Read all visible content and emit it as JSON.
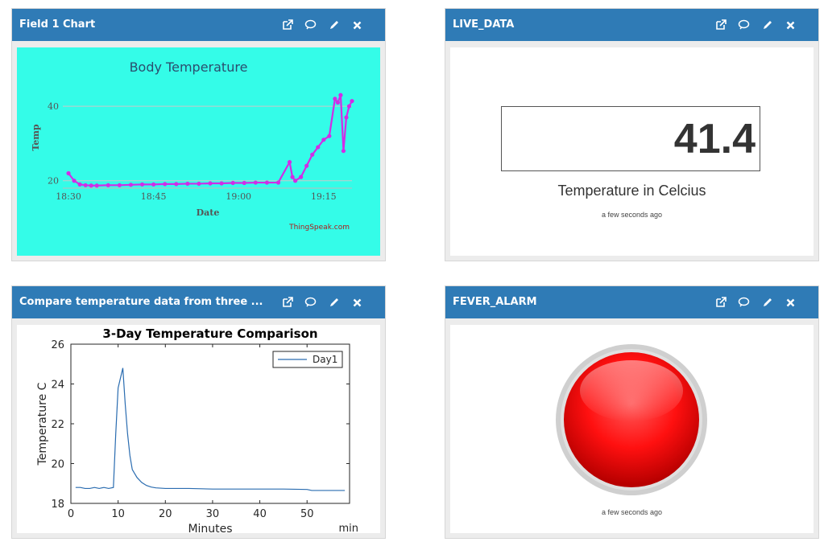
{
  "widgets": {
    "field_chart": {
      "title": "Field 1 Chart"
    },
    "live_data": {
      "title": "LIVE_DATA",
      "value": "41.4",
      "label": "Temperature in Celcius",
      "updated": "a few seconds ago"
    },
    "compare": {
      "title": "Compare temperature data from three ..."
    },
    "fever_alarm": {
      "title": "FEVER_ALARM",
      "updated": "a few seconds ago",
      "lamp_color": "#e80000",
      "lamp_state": "on"
    }
  },
  "colors": {
    "header": "#2f7bb6",
    "chart1_bg": "#34fce8",
    "chart1_line": "#d22ce6",
    "chart3_line": "#2a6cb0"
  },
  "icons": [
    "external-link-icon",
    "comment-icon",
    "pencil-icon",
    "close-icon"
  ],
  "chart_data": [
    {
      "type": "line",
      "title": "Body Temperature",
      "xlabel": "Date",
      "ylabel": "Temp",
      "x_ticks": [
        "18:30",
        "18:45",
        "19:00",
        "19:15"
      ],
      "y_ticks": [
        20,
        40
      ],
      "ylim": [
        18,
        45
      ],
      "xlim": [
        "18:29",
        "19:20"
      ],
      "credit": "ThingSpeak.com",
      "grid": "horizontal",
      "series": [
        {
          "x": [
            "18:30",
            "18:31",
            "18:32",
            "18:33",
            "18:34",
            "18:35",
            "18:37",
            "18:39",
            "18:41",
            "18:43",
            "18:45",
            "18:47",
            "18:49",
            "18:51",
            "18:53",
            "18:55",
            "18:57",
            "18:59",
            "19:01",
            "19:03",
            "19:05",
            "19:07",
            "19:09",
            "19:09",
            "19:10",
            "19:11",
            "19:12",
            "19:13",
            "19:14",
            "19:15",
            "19:16",
            "19:17",
            "19:17",
            "19:18",
            "19:18",
            "19:19",
            "19:19",
            "19:20"
          ],
          "values": [
            22,
            20,
            19,
            18.8,
            18.7,
            18.7,
            18.8,
            18.8,
            18.9,
            19,
            19,
            19.1,
            19.1,
            19.2,
            19.2,
            19.3,
            19.3,
            19.4,
            19.4,
            19.5,
            19.5,
            19.5,
            25,
            21,
            20,
            21,
            24,
            27,
            29,
            31,
            32,
            42,
            41,
            43,
            28,
            37,
            40,
            41.4
          ]
        }
      ]
    },
    {
      "type": "line",
      "title": "3-Day Temperature Comparison",
      "xlabel": "Minutes",
      "ylabel": "Temperature C",
      "x_unit_label": "min",
      "x_ticks": [
        0,
        10,
        20,
        30,
        40,
        50
      ],
      "y_ticks": [
        18,
        20,
        22,
        24,
        26
      ],
      "xlim": [
        0,
        59
      ],
      "ylim": [
        18,
        26
      ],
      "legend": "top-right",
      "series": [
        {
          "name": "Day1",
          "x": [
            1,
            2,
            3,
            4,
            5,
            6,
            7,
            8,
            9,
            9.5,
            10,
            10.5,
            11,
            11.5,
            12,
            12.5,
            13,
            14,
            15,
            16,
            17,
            18,
            20,
            25,
            30,
            35,
            40,
            45,
            50,
            51,
            55,
            58
          ],
          "values": [
            18.8,
            18.8,
            18.75,
            18.75,
            18.8,
            18.75,
            18.8,
            18.75,
            18.8,
            21.5,
            23.8,
            24.3,
            24.8,
            23,
            21.5,
            20.4,
            19.7,
            19.3,
            19.05,
            18.9,
            18.82,
            18.78,
            18.75,
            18.75,
            18.72,
            18.72,
            18.72,
            18.72,
            18.7,
            18.65,
            18.65,
            18.65
          ]
        }
      ]
    }
  ]
}
